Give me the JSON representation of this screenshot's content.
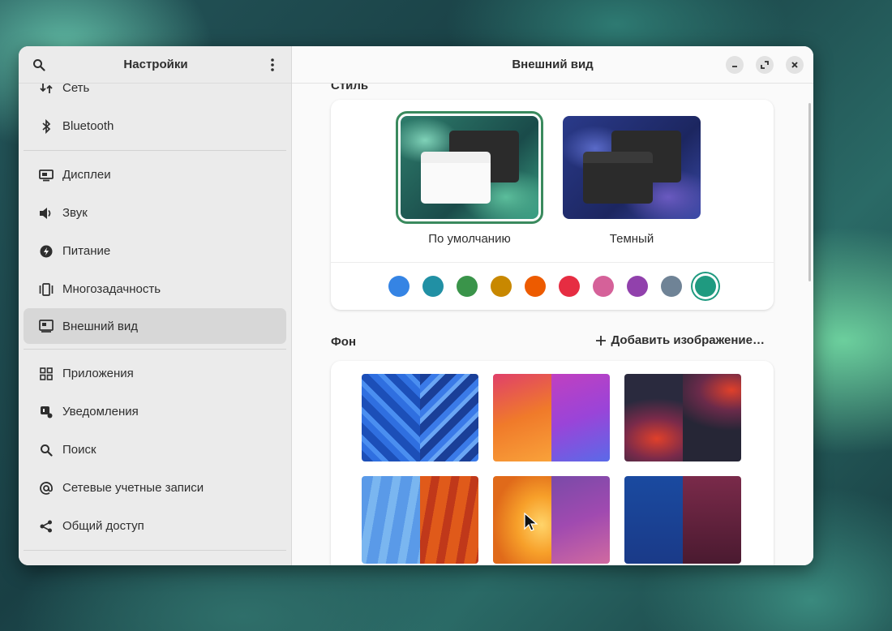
{
  "sidebar": {
    "title": "Настройки",
    "items_group1": [
      {
        "label": "Сеть",
        "icon": "network-icon"
      },
      {
        "label": "Bluetooth",
        "icon": "bluetooth-icon"
      }
    ],
    "items_group2": [
      {
        "label": "Дисплеи",
        "icon": "display-icon"
      },
      {
        "label": "Звук",
        "icon": "sound-icon"
      },
      {
        "label": "Питание",
        "icon": "power-icon"
      },
      {
        "label": "Многозадачность",
        "icon": "multitasking-icon"
      },
      {
        "label": "Внешний вид",
        "icon": "appearance-icon",
        "active": true
      }
    ],
    "items_group3": [
      {
        "label": "Приложения",
        "icon": "apps-icon"
      },
      {
        "label": "Уведомления",
        "icon": "notifications-icon"
      },
      {
        "label": "Поиск",
        "icon": "search-icon"
      },
      {
        "label": "Сетевые учетные записи",
        "icon": "online-accounts-icon"
      },
      {
        "label": "Общий доступ",
        "icon": "sharing-icon"
      }
    ]
  },
  "content": {
    "title": "Внешний вид",
    "style_section_label": "Стиль",
    "styles": [
      {
        "label": "По умолчанию",
        "selected": true
      },
      {
        "label": "Темный",
        "selected": false
      }
    ],
    "accent_colors": [
      "#3584e4",
      "#2190a4",
      "#3a944a",
      "#c88800",
      "#ed5b00",
      "#e62d42",
      "#d56199",
      "#9141ac",
      "#6f8396",
      "#1f9a80"
    ],
    "accent_selected_index": 9,
    "background_section_label": "Фон",
    "add_image_label": "Добавить изображение…"
  },
  "colors": {
    "accent_selected": "#1f9a80",
    "style_selected_border": "#3a8a5e"
  }
}
